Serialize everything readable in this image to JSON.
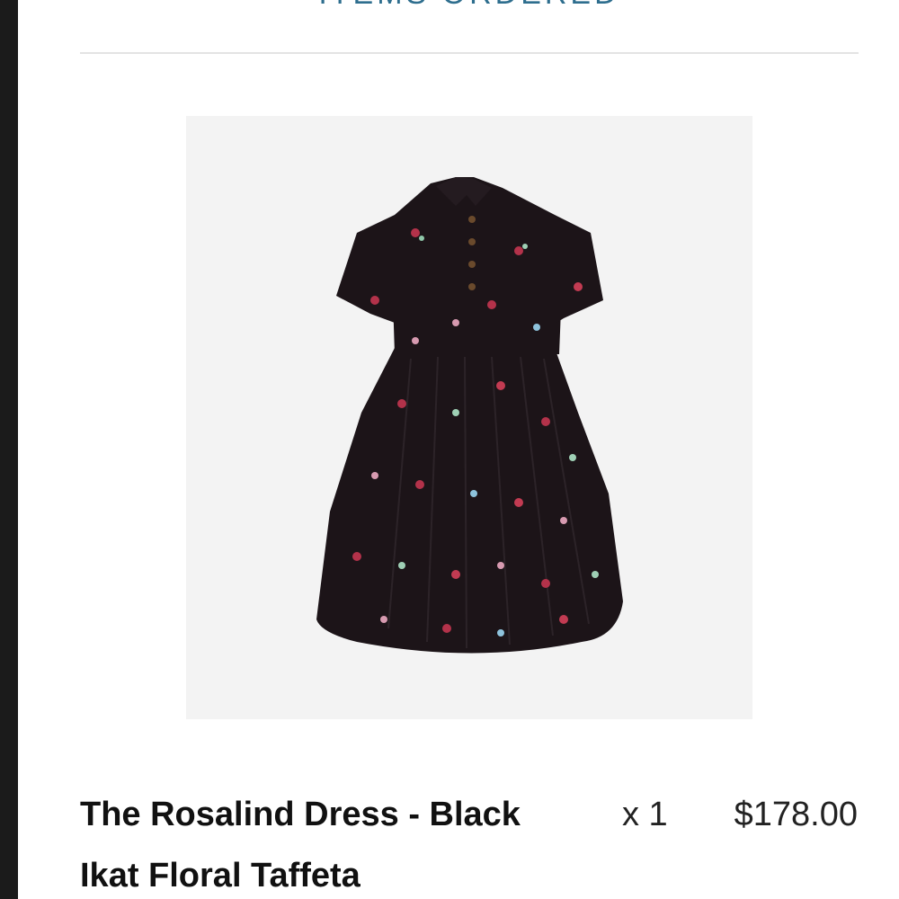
{
  "order": {
    "section_title": "ITEMS ORDERED",
    "items": [
      {
        "name": "The Rosalind Dress - Black Ikat Floral Taffeta",
        "quantity": "x 1",
        "price": "$178.00",
        "image_icon": "dress-product-image"
      }
    ]
  },
  "colors": {
    "accent": "#2e6e8e",
    "dress": "#1c1418",
    "image_background": "#f3f3f3"
  }
}
